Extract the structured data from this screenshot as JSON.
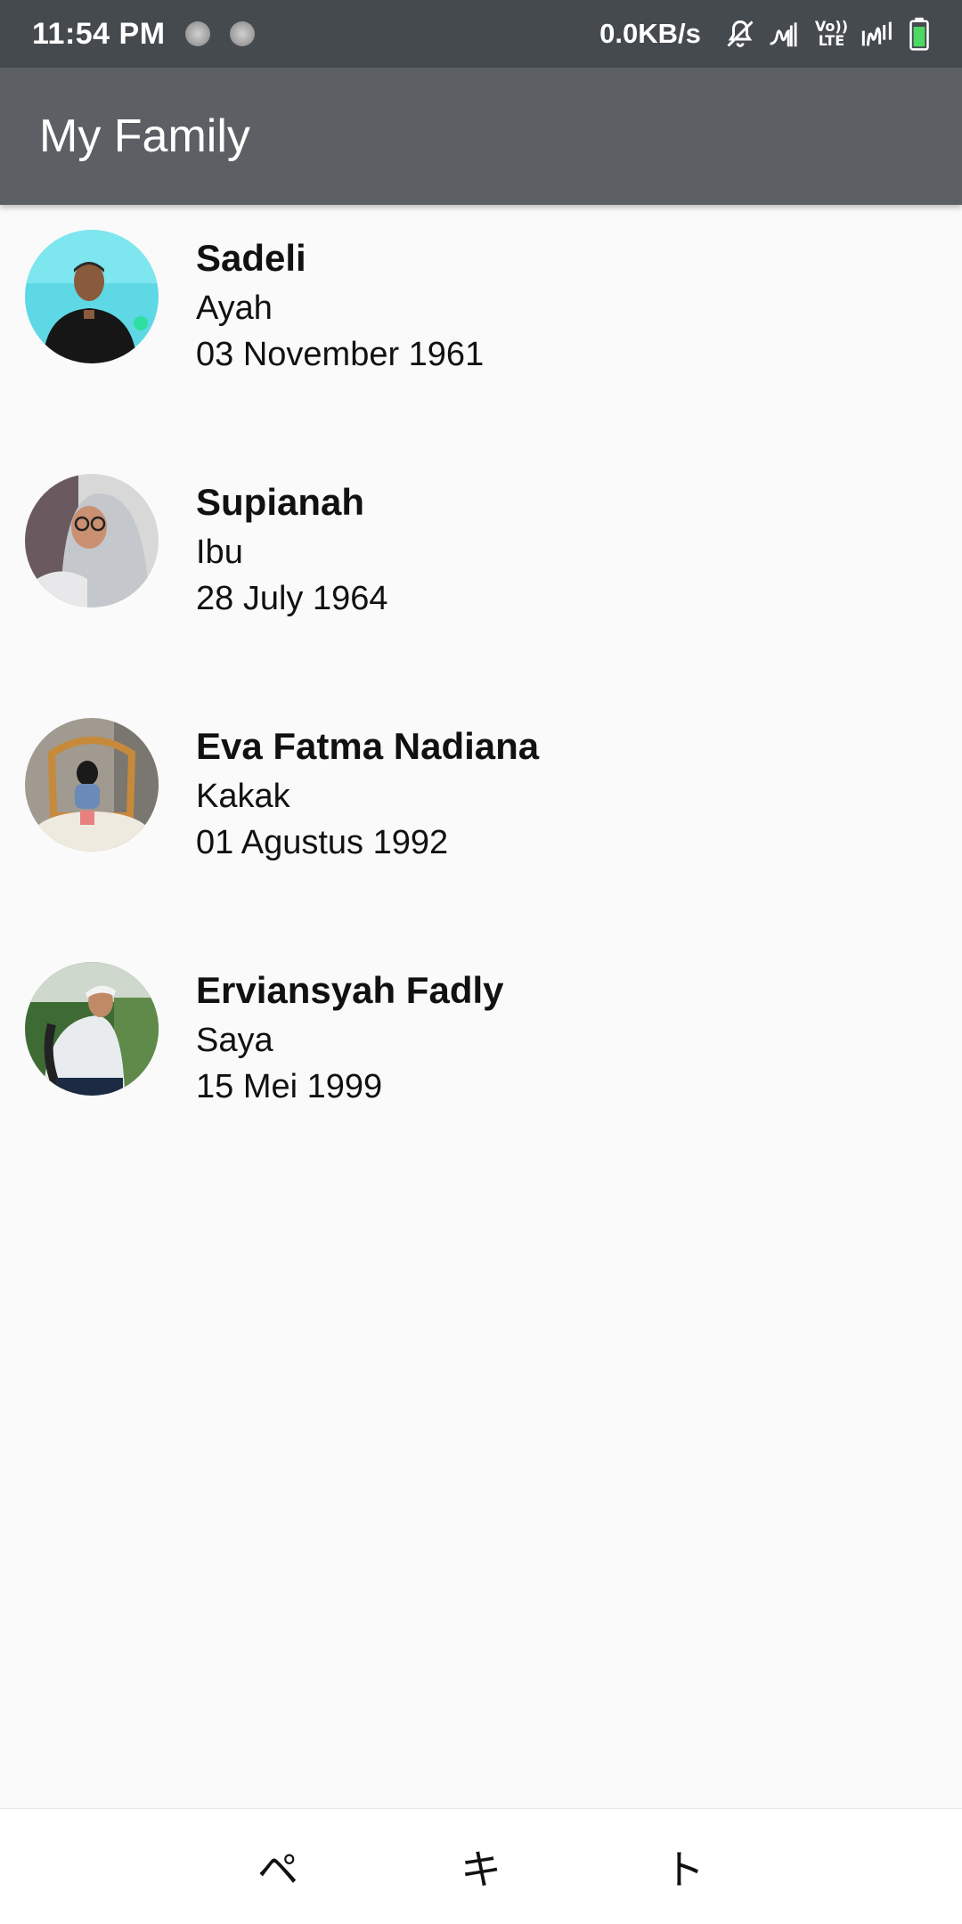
{
  "status_bar": {
    "time": "11:54 PM",
    "speed": "0.0KB/s",
    "lte_top": "Vo))",
    "lte_bottom": "LTE",
    "icons": [
      "notification-dot-icon",
      "notification-dot-icon",
      "bell-off-icon",
      "signal-icon",
      "volte-icon",
      "signal-2-icon",
      "battery-icon"
    ]
  },
  "app_bar": {
    "title": "My Family"
  },
  "members": [
    {
      "name": "Sadeli",
      "role": "Ayah",
      "date": "03 November 1961"
    },
    {
      "name": "Supianah",
      "role": "Ibu",
      "date": "28 July 1964"
    },
    {
      "name": "Eva Fatma Nadiana",
      "role": "Kakak",
      "date": "01 Agustus 1992"
    },
    {
      "name": "Erviansyah Fadly",
      "role": "Saya",
      "date": "15 Mei 1999"
    }
  ],
  "bottom_nav": {
    "left": "ペ",
    "center": "キ",
    "right": "ト"
  },
  "colors": {
    "status_bar": "#454a4f",
    "app_bar": "#5c6064",
    "background": "#fafafa",
    "battery": "#4cd964"
  }
}
